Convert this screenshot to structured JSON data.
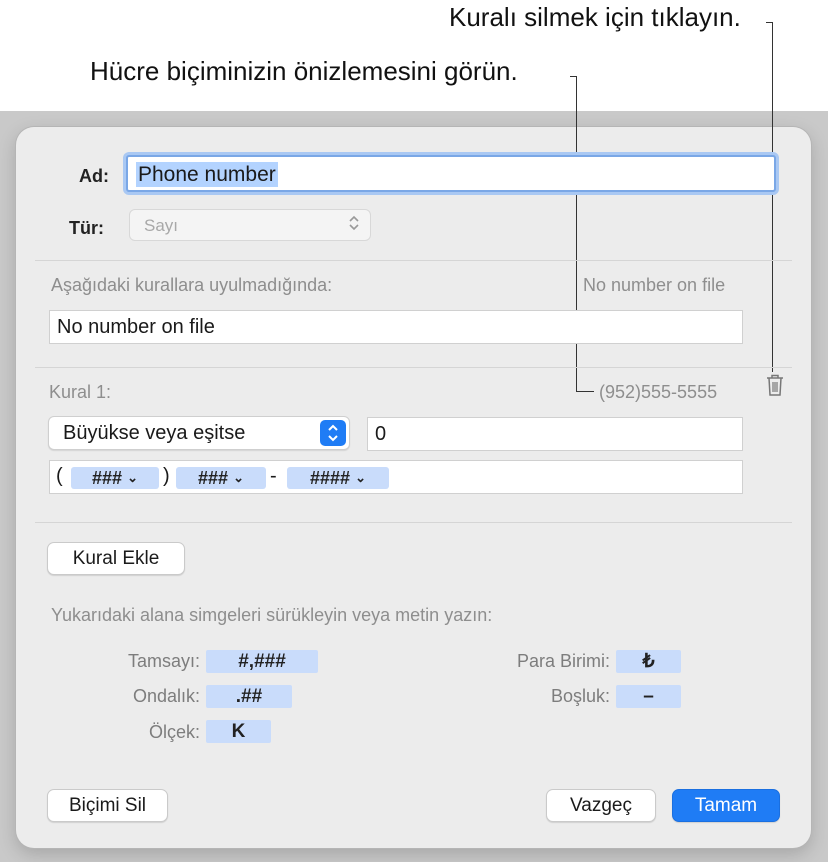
{
  "callouts": {
    "delete_rule": "Kuralı silmek için tıklayın.",
    "preview": "Hücre biçiminizin önizlemesini görün."
  },
  "form": {
    "name_label": "Ad:",
    "name_value": "Phone number",
    "type_label": "Tür:",
    "type_value": "Sayı"
  },
  "fallback": {
    "label": "Aşağıdaki kurallara uyulmadığında:",
    "preview": "No number on file",
    "value": "No number on file"
  },
  "rule1": {
    "label": "Kural 1:",
    "preview": "(952)555-5555",
    "condition": "Büyükse veya eşitse",
    "condition_value": "0",
    "format": {
      "open_paren": "(",
      "token1": "###",
      "close_paren": ")",
      "token2": "###",
      "dash": "-",
      "token3": "####",
      "token_chevron": "⌄"
    }
  },
  "buttons": {
    "add_rule": "Kural Ekle",
    "clear_format": "Biçimi Sil",
    "cancel": "Vazgeç",
    "ok": "Tamam"
  },
  "symbols": {
    "hint": "Yukarıdaki alana simgeleri sürükleyin veya metin yazın:",
    "integer_label": "Tamsayı:",
    "integer_token": "#,###",
    "decimal_label": "Ondalık:",
    "decimal_token": ".##",
    "scale_label": "Ölçek:",
    "scale_token": "K",
    "currency_label": "Para Birimi:",
    "currency_token": "₺",
    "space_label": "Boşluk:",
    "space_token": "–"
  },
  "icons": {
    "trash": "trash-icon",
    "popup_arrows": "up-down-chevron-icon"
  },
  "colors": {
    "accent": "#1f7cf5",
    "token_bg": "#c9dcfb",
    "dialog_bg": "#ececec"
  }
}
